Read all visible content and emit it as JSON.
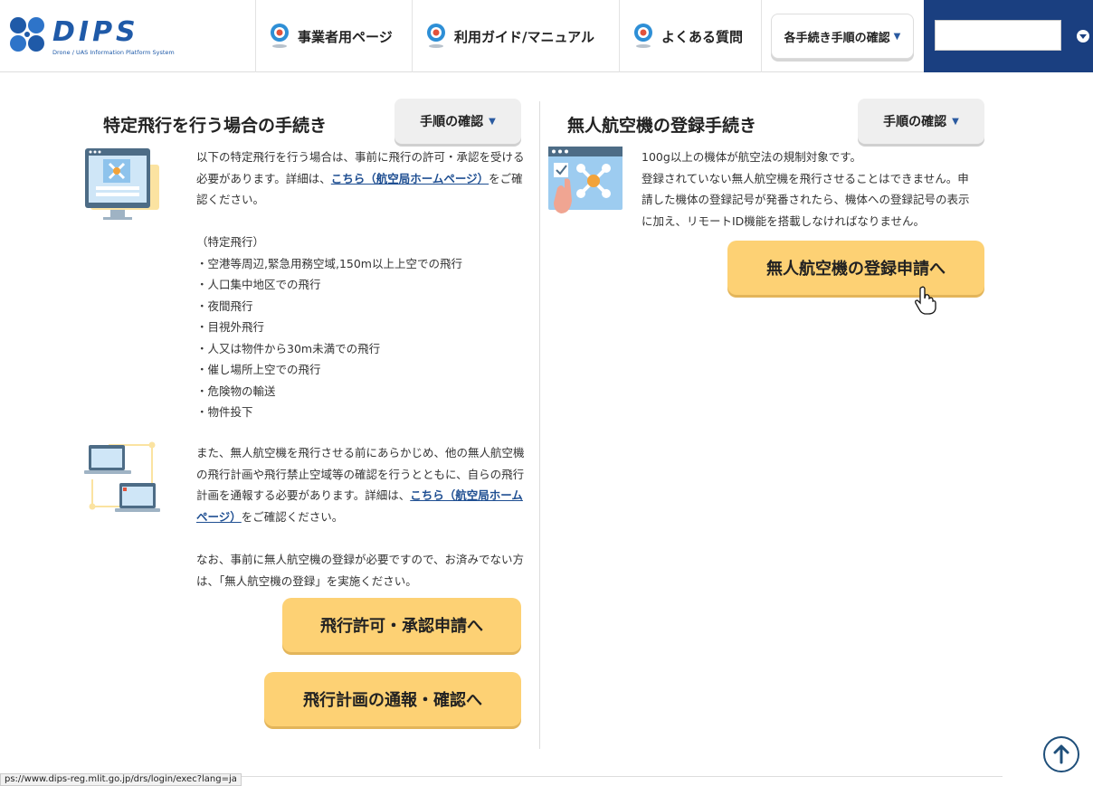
{
  "header": {
    "logo_text": "DIPS",
    "logo_sub": "Drone / UAS Information Platform System",
    "nav": [
      {
        "label": "事業者用ページ"
      },
      {
        "label": "利用ガイド/マニュアル"
      },
      {
        "label": "よくある質問"
      }
    ],
    "procedures_dropdown": "各手続き手順の確認",
    "language_value": ""
  },
  "left": {
    "title": "特定飛行を行う場合の手続き",
    "proc_button": "手順の確認",
    "intro_1": "以下の特定飛行を行う場合は、事前に飛行の許可・承認を受ける必要があります。詳細は、",
    "intro_link": "こちら（航空局ホームページ）",
    "intro_2": "をご確認ください。",
    "list_heading": "（特定飛行）",
    "list": [
      "・空港等周辺,緊急用務空域,150m以上上空での飛行",
      "・人口集中地区での飛行",
      "・夜間飛行",
      "・目視外飛行",
      "・人又は物件から30m未満での飛行",
      "・催し場所上空での飛行",
      "・危険物の輸送",
      "・物件投下"
    ],
    "plan_1": "また、無人航空機を飛行させる前にあらかじめ、他の無人航空機の飛行計画や飛行禁止空域等の確認を行うとともに、自らの飛行計画を通報する必要があります。詳細は、",
    "plan_link": "こちら（航空局ホームページ）",
    "plan_2": "をご確認ください。",
    "note": "なお、事前に無人航空機の登録が必要ですので、お済みでない方は、「無人航空機の登録」を実施ください。",
    "btn_permit": "飛行許可・承認申請へ",
    "btn_plan": "飛行計画の通報・確認へ"
  },
  "right": {
    "title": "無人航空機の登録手続き",
    "proc_button": "手順の確認",
    "text_lines": [
      "100g以上の機体が航空法の規制対象です。",
      "登録されていない無人航空機を飛行させることはできません。申",
      "請した機体の登録記号が発番されたら、機体への登録記号の表示",
      "に加え、リモートID機能を搭載しなければなりません。"
    ],
    "btn_register": "無人航空機の登録申請へ"
  },
  "status_url": "ps://www.dips-reg.mlit.go.jp/drs/login/exec?lang=ja",
  "colors": {
    "brand_blue": "#1a3f80",
    "button_yellow": "#fdd174",
    "link": "#1f4f92"
  },
  "icons": [
    "drone-logo-icon",
    "flag-icon",
    "caret-down-icon",
    "arrow-up-icon",
    "hand-pointer-icon"
  ]
}
